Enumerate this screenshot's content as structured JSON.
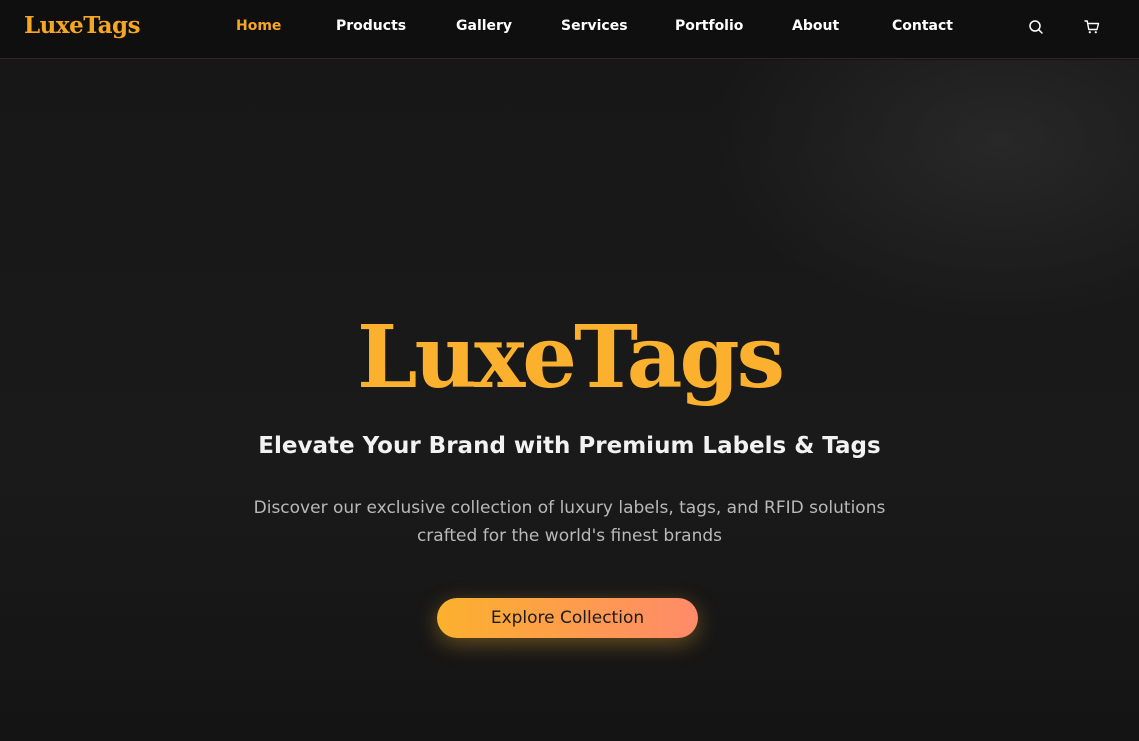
{
  "brand": {
    "name": "LuxeTags",
    "accent_color": "#f5a623"
  },
  "nav": {
    "items": [
      {
        "label": "Home",
        "active": true
      },
      {
        "label": "Products",
        "active": false
      },
      {
        "label": "Gallery",
        "active": false
      },
      {
        "label": "Services",
        "active": false
      },
      {
        "label": "Portfolio",
        "active": false
      },
      {
        "label": "About",
        "active": false
      },
      {
        "label": "Contact",
        "active": false
      }
    ],
    "icons": [
      "search-icon",
      "cart-icon"
    ]
  },
  "hero": {
    "title": "LuxeTags",
    "subtitle": "Elevate Your Brand with Premium Labels & Tags",
    "description_line1": "Discover our exclusive collection of luxury labels, tags, and RFID solutions",
    "description_line2": "crafted for the world's finest brands",
    "cta_label": "Explore Collection",
    "cta_gradient": [
      "#fbb12d",
      "#ff8a6a"
    ]
  }
}
